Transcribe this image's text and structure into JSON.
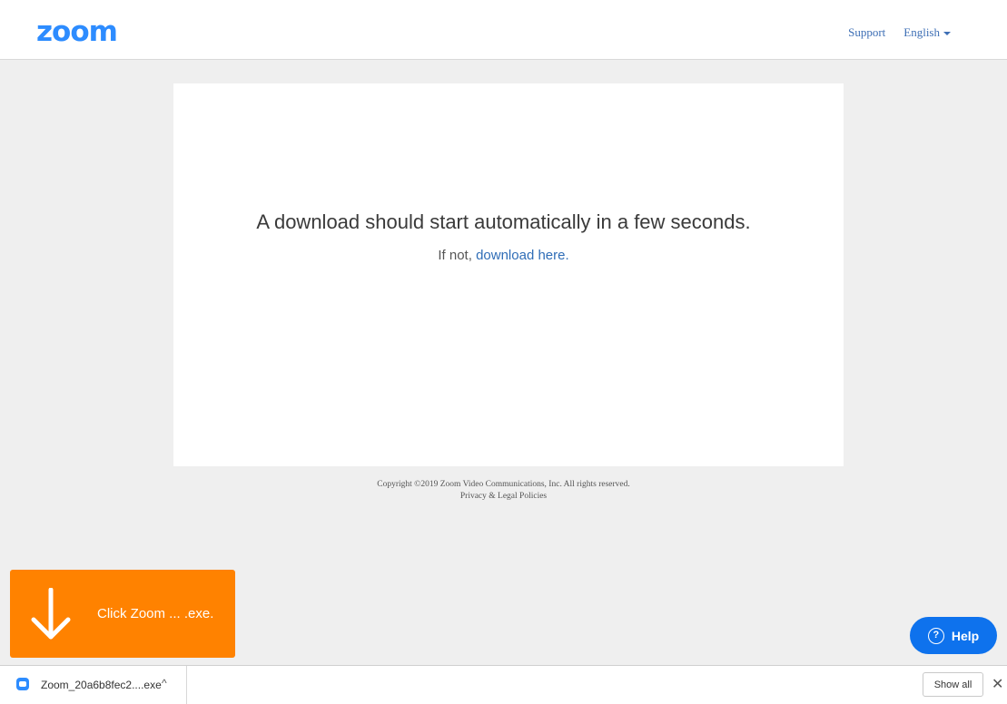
{
  "header": {
    "logo_text": "zoom",
    "support_label": "Support",
    "language_label": "English"
  },
  "main": {
    "headline": "A download should start automatically in a few seconds.",
    "fallback_prefix": "If not,",
    "fallback_link": "download here."
  },
  "footer": {
    "copyright": "Copyright ©2019 Zoom Video Communications, Inc. All rights reserved.",
    "policies_link": "Privacy & Legal Policies"
  },
  "download_hint": {
    "text": "Click Zoom ... .exe."
  },
  "help_button": {
    "label": "Help"
  },
  "download_shelf": {
    "file_name": "Zoom_20a6b8fec2....exe",
    "show_all_label": "Show all"
  },
  "colors": {
    "brand": "#2d8cff",
    "link": "#2f6db7",
    "hint_bg": "#ff8200",
    "help_bg": "#0e72ed"
  },
  "icons": [
    "zoom-logo",
    "caret-down-icon",
    "arrow-down-icon",
    "help-icon",
    "zoom-file-icon",
    "chevron-up-icon",
    "close-icon"
  ]
}
